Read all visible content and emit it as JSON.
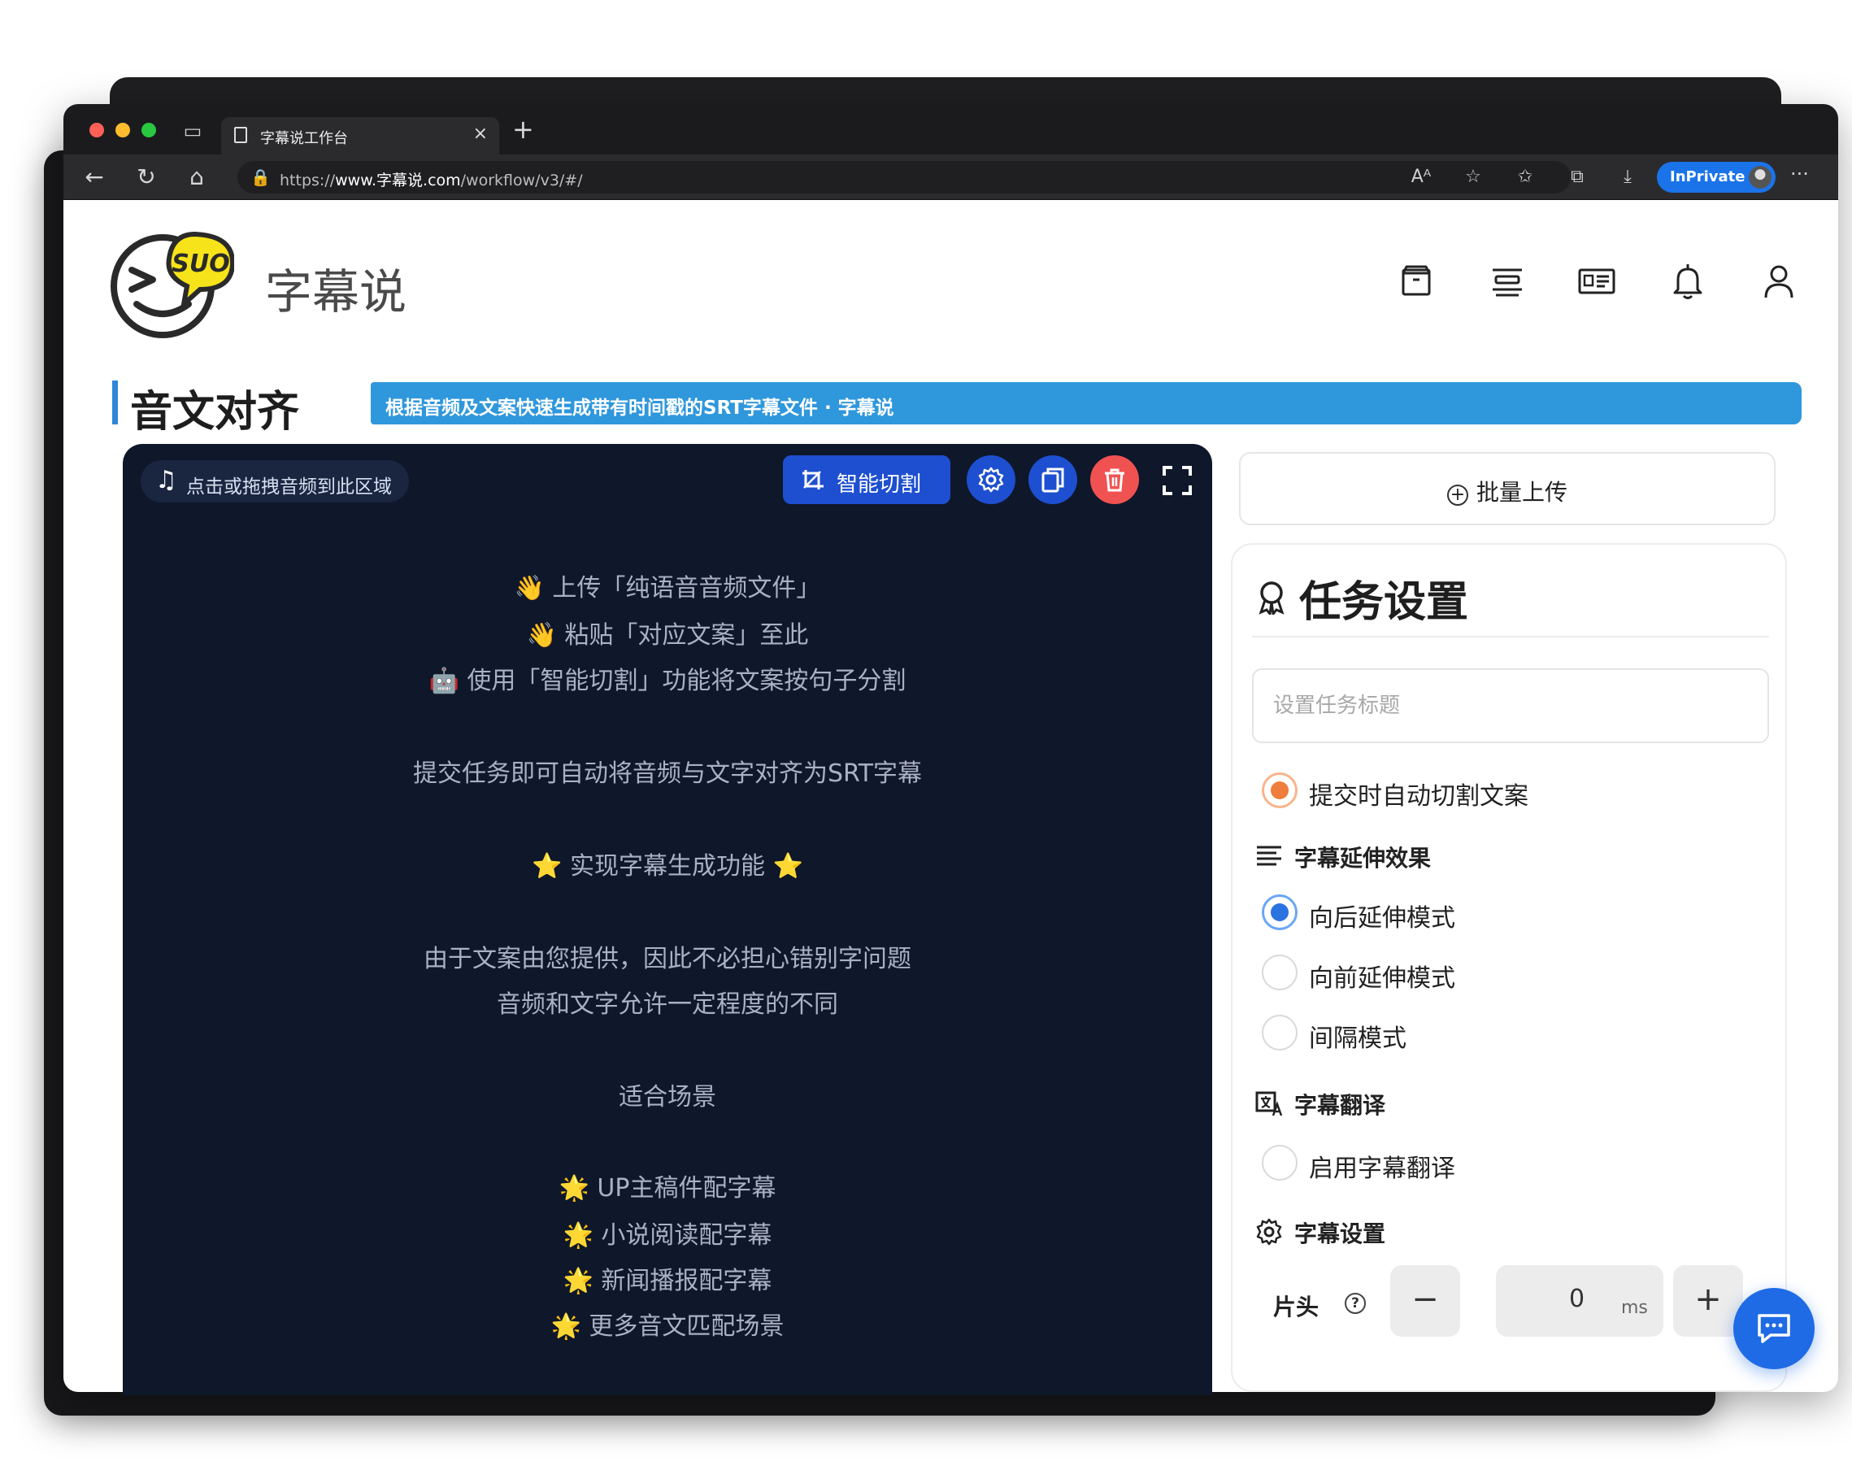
{
  "browser": {
    "tab_title": "字幕说工作台",
    "url_prefix": "https://",
    "url_host": "www.字幕说.com",
    "url_path": "/workflow/v3/#/",
    "inprivate_label": "InPrivate"
  },
  "site": {
    "logo_text": "SUO",
    "brand_name": "字幕说",
    "header_icons": [
      "archive-icon",
      "align-icon",
      "id-card-icon",
      "bell-icon",
      "user-icon"
    ]
  },
  "page": {
    "title": "音文对齐",
    "subtitle": "根据音频及文案快速生成带有时间戳的SRT字幕文件 · 字幕说"
  },
  "editor": {
    "drop_label": "点击或拖拽音频到此区域",
    "smart_cut_label": "智能切割",
    "guide_lines": [
      "👋 上传「纯语音音频文件」",
      "👋 粘贴「对应文案」至此",
      "🤖 使用「智能切割」功能将文案按句子分割",
      "提交任务即可自动将音频与文字对齐为SRT字幕",
      "⭐ 实现字幕生成功能 ⭐",
      "由于文案由您提供，因此不必担心错别字问题",
      "音频和文字允许一定程度的不同",
      "适合场景",
      "🌟 UP主稿件配字幕",
      "🌟 小说阅读配字幕",
      "🌟 新闻播报配字幕",
      "🌟 更多音文匹配场景"
    ],
    "colors": {
      "bg": "#0f172a",
      "primary": "#1d4fd0",
      "danger": "#f05252"
    }
  },
  "sidebar": {
    "batch_upload_label": "批量上传",
    "settings_title": "任务设置",
    "task_title_placeholder": "设置任务标题",
    "auto_cut_label": "提交时自动切割文案",
    "extend_section": "字幕延伸效果",
    "extend_options": [
      "向后延伸模式",
      "向前延伸模式",
      "间隔模式"
    ],
    "extend_selected": "向后延伸模式",
    "translate_section": "字幕翻译",
    "translate_option": "启用字幕翻译",
    "subtitle_section": "字幕设置",
    "head_offset_label": "片头",
    "head_offset_value": "0",
    "head_offset_unit": "ms"
  }
}
